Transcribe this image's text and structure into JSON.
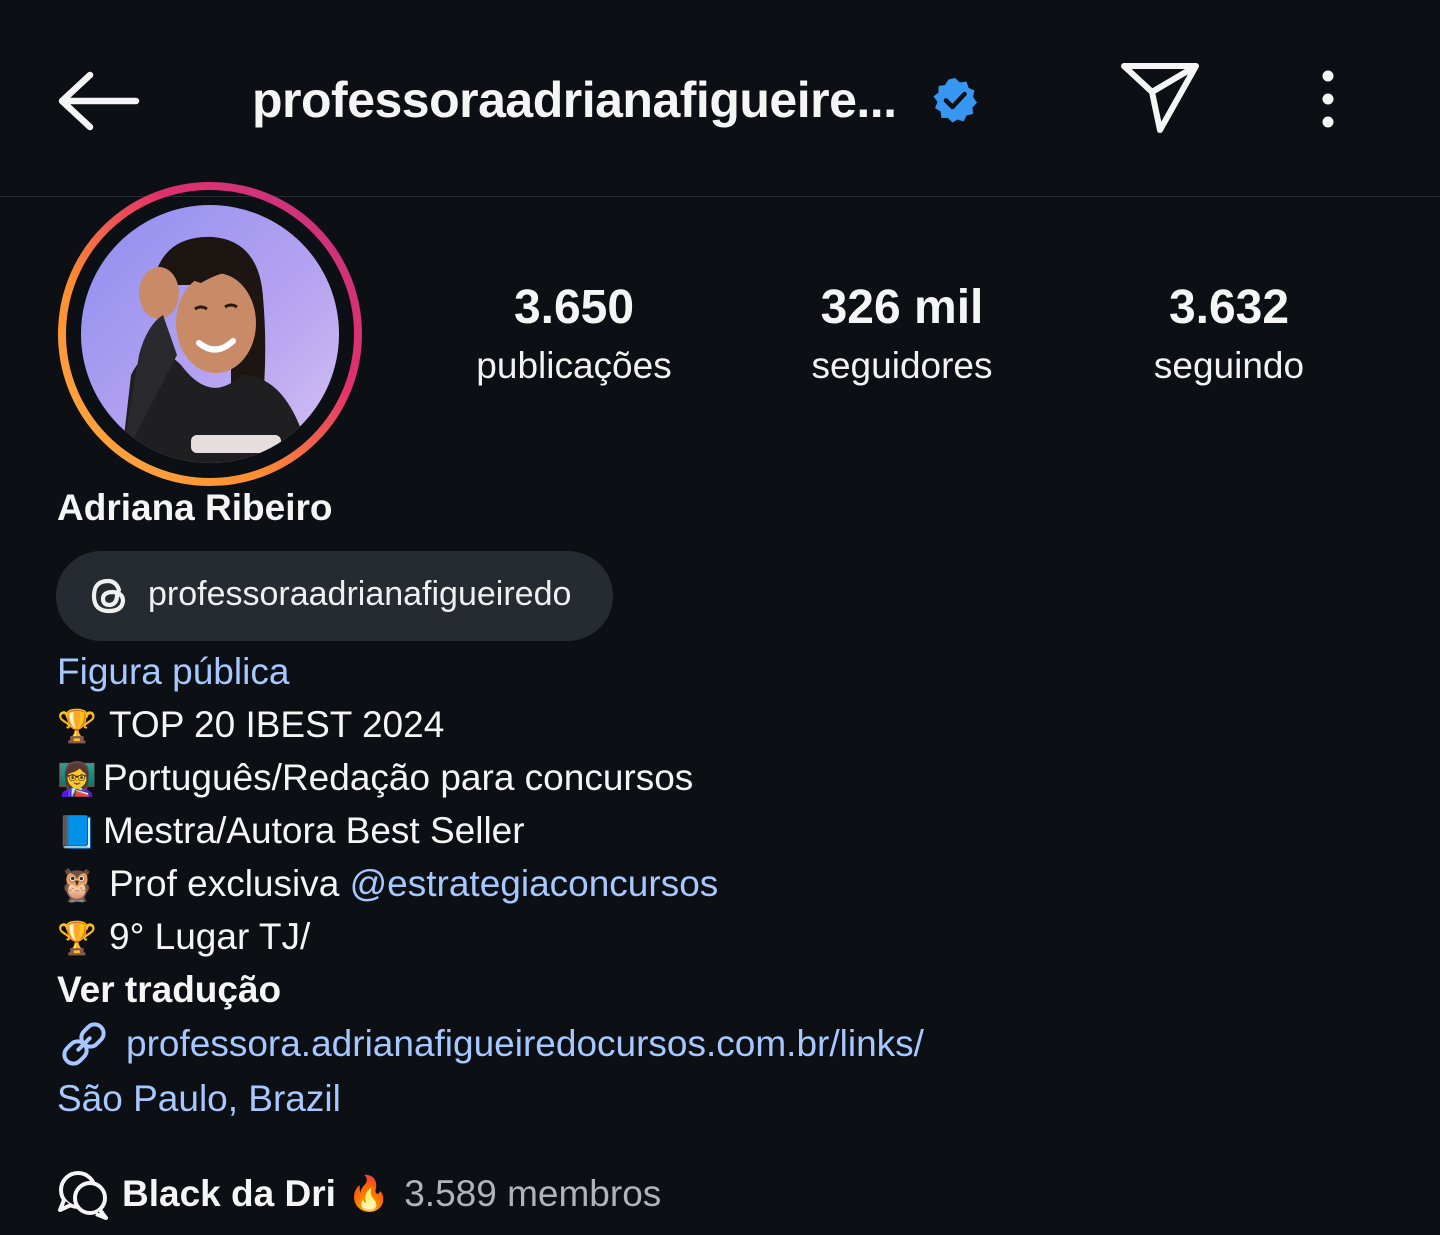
{
  "header": {
    "username": "professoraadrianafigueire...",
    "verified_color": "#3797f0"
  },
  "stats": [
    {
      "value": "3.650",
      "label": "publicações"
    },
    {
      "value": "326 mil",
      "label": "seguidores"
    },
    {
      "value": "3.632",
      "label": "seguindo"
    }
  ],
  "profile": {
    "full_name": "Adriana Ribeiro",
    "threads_handle": "professoraadrianafigueiredo",
    "category": "Figura pública",
    "bio": [
      {
        "emoji": "🏆",
        "text": "TOP 20 IBEST 2024"
      },
      {
        "emoji": "👩‍🏫",
        "text": "Português/Redação para concursos"
      },
      {
        "emoji": "📘",
        "text": "Mestra/Autora Best Seller"
      },
      {
        "emoji": "🦉",
        "text": "Prof exclusiva ",
        "mention": "@estrategiaconcursos"
      },
      {
        "emoji": "🏆",
        "text": "9° Lugar TJ/"
      }
    ],
    "see_translation": "Ver tradução",
    "link": "professora.adrianafigueiredocursos.com.br/links/",
    "location": "São Paulo, Brazil"
  },
  "channel": {
    "name": "Black da Dri",
    "emoji": "🔥",
    "members": "3.589 membros"
  },
  "colors": {
    "background": "#0c0f14",
    "link_blue": "#a6c8ff",
    "pill_bg": "#262a31"
  },
  "icons": [
    "back-arrow-icon",
    "verified-badge-icon",
    "send-icon",
    "more-options-icon",
    "threads-icon",
    "link-icon",
    "broadcast-channel-icon"
  ]
}
